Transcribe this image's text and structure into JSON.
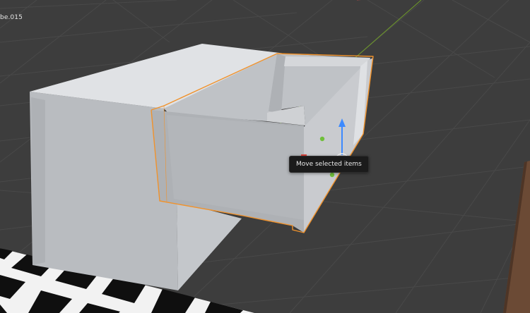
{
  "viewport": {
    "object_name": "be.015",
    "tooltip": "Move selected items"
  },
  "colors": {
    "background": "#3d3d3d",
    "grid_line": "#4a4a4a",
    "x_axis": "#b34a4a",
    "y_axis": "#6f9a2a",
    "selection_outline": "#f0922c",
    "gizmo_z": "#3d8aff",
    "gizmo_y": "#6fbf3a",
    "gizmo_x": "#e0443c",
    "floor_wood": "#6b4a35"
  },
  "icons": {
    "move_gizmo": "move-gizmo-icon"
  }
}
